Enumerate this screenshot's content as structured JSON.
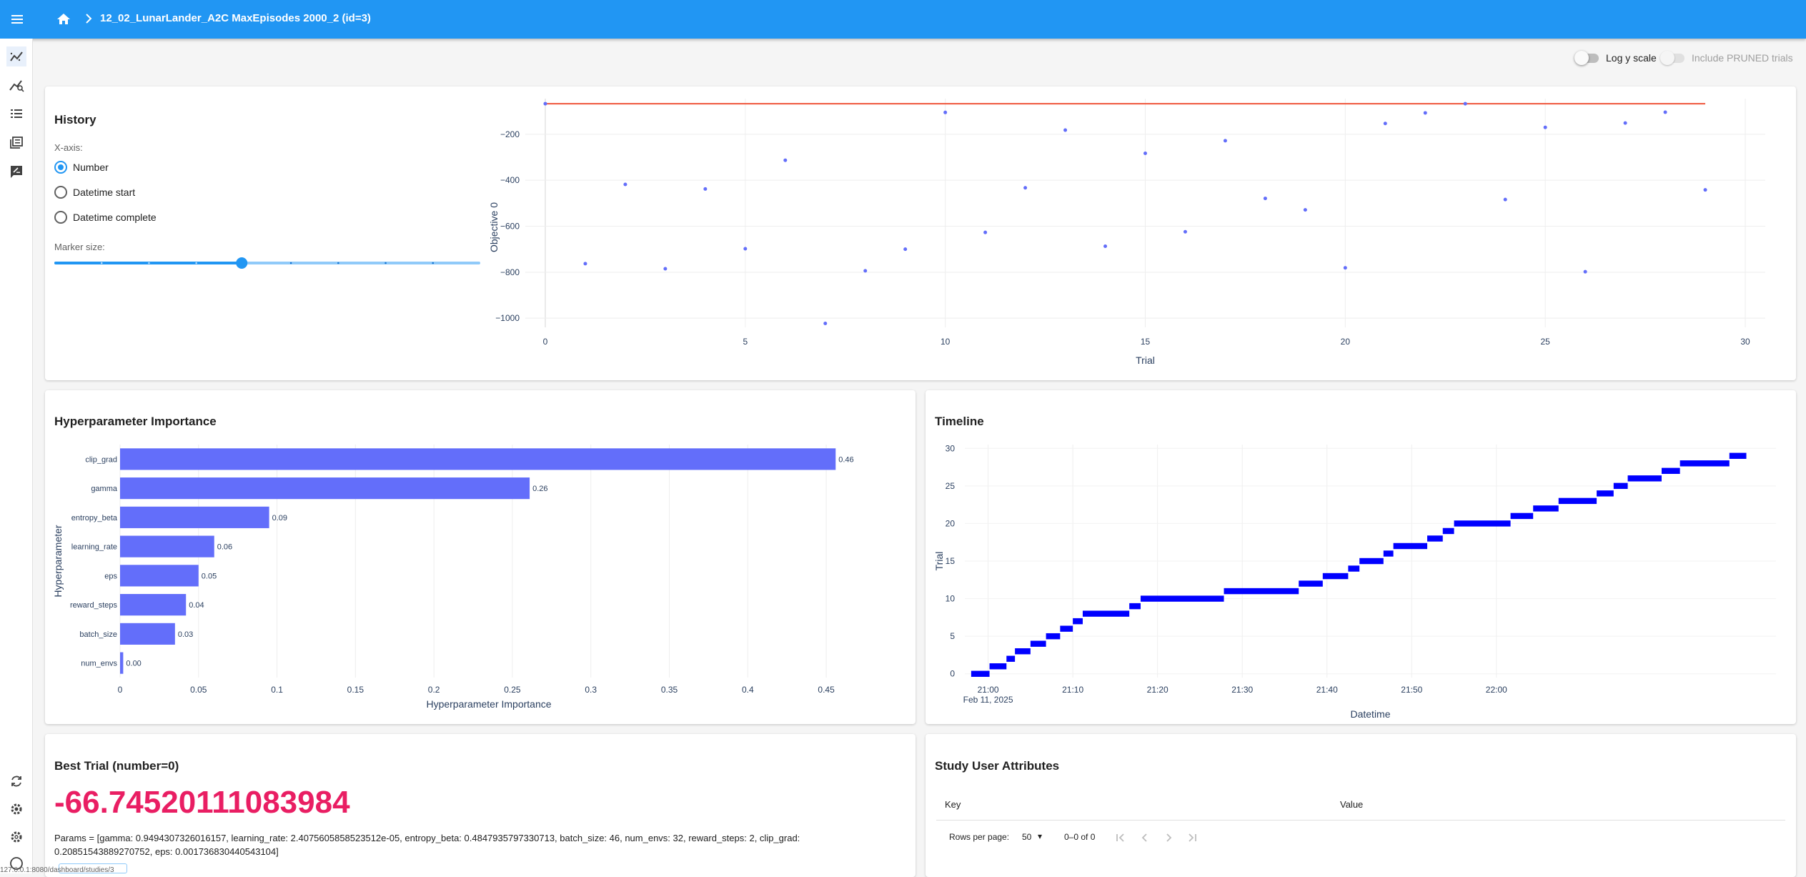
{
  "app": {
    "title": "12_02_LunarLander_A2C MaxEpisodes 2000_2 (id=3)",
    "accent_color": "#2196f3"
  },
  "sidebar": {
    "items": [
      {
        "icon": "history-chart-icon",
        "active": true
      },
      {
        "icon": "analytics-icon",
        "active": false
      },
      {
        "icon": "table-list-icon",
        "active": false
      },
      {
        "icon": "library-icon",
        "active": false
      },
      {
        "icon": "note-icon",
        "active": false
      }
    ],
    "bottom_items": [
      {
        "icon": "refresh-icon"
      },
      {
        "icon": "settings-icon"
      },
      {
        "icon": "gear-icon"
      },
      {
        "icon": "help-icon"
      }
    ]
  },
  "history": {
    "title": "History",
    "log_scale_label": "Log y scale",
    "pruned_label": "Include PRUNED trials",
    "xaxis_label": "X-axis:",
    "xaxis_options": [
      "Number",
      "Datetime start",
      "Datetime complete"
    ],
    "xaxis_selected": "Number",
    "marker_size_label": "Marker size:",
    "marker_size_fraction": 0.44
  },
  "importance": {
    "title": "Hyperparameter Importance"
  },
  "timeline": {
    "title": "Timeline"
  },
  "best_trial": {
    "title": "Best Trial (number=0)",
    "value": "-66.74520111083984",
    "params_text": "Params = [gamma: 0.9494307326016157, learning_rate: 2.4075605858523512e-05, entropy_beta: 0.4847935797330713, batch_size: 46, num_envs: 32, reward_steps: 2, clip_grad: 0.20851543889270752, eps: 0.001736830440543104]"
  },
  "user_attrs": {
    "title": "Study User Attributes",
    "columns": [
      "Key",
      "Value"
    ],
    "rows_per_page_label": "Rows per page:",
    "rows_per_page": "50",
    "range": "0–0 of 0"
  },
  "status_text": "127.0.0.1:8080/dashboard/studies/3",
  "chart_data": [
    {
      "type": "scatter",
      "xlabel": "Trial",
      "ylabel": "Objective 0",
      "xlim": [
        -0.5,
        30.5
      ],
      "ylim": [
        -1040,
        -45
      ],
      "xticks": [
        0,
        5,
        10,
        15,
        20,
        25,
        30
      ],
      "yticks": [
        -200,
        -400,
        -600,
        -800,
        -1000
      ],
      "grid": true,
      "color": "#636efa",
      "best_line_color": "#ef553b",
      "x": [
        0,
        1,
        2,
        3,
        4,
        5,
        6,
        7,
        8,
        9,
        10,
        11,
        12,
        13,
        14,
        15,
        16,
        17,
        18,
        19,
        20,
        21,
        22,
        23,
        24,
        25,
        26,
        27,
        28,
        29
      ],
      "values": [
        -67,
        -763,
        -418,
        -785,
        -438,
        -698,
        -313,
        -1023,
        -794,
        -700,
        -105,
        -627,
        -433,
        -182,
        -687,
        -283,
        -624,
        -228,
        -479,
        -529,
        -781,
        -153,
        -107,
        -67,
        -484,
        -170,
        -798,
        -151,
        -104,
        -442
      ],
      "best_values": [
        -67,
        -67,
        -67,
        -67,
        -67,
        -67,
        -67,
        -67,
        -67,
        -67,
        -67,
        -67,
        -67,
        -67,
        -67,
        -67,
        -67,
        -67,
        -67,
        -67,
        -67,
        -67,
        -67,
        -67,
        -67,
        -67,
        -67,
        -67,
        -67,
        -67
      ]
    },
    {
      "type": "bar",
      "orientation": "horizontal",
      "xlabel": "Hyperparameter Importance",
      "ylabel": "Hyperparameter",
      "xlim": [
        0,
        0.47
      ],
      "xticks": [
        "0",
        "0.05",
        "0.1",
        "0.15",
        "0.2",
        "0.25",
        "0.3",
        "0.35",
        "0.4",
        "0.45"
      ],
      "color": "#636efa",
      "categories": [
        "clip_grad",
        "gamma",
        "entropy_beta",
        "learning_rate",
        "eps",
        "reward_steps",
        "batch_size",
        "num_envs"
      ],
      "values": [
        0.456,
        0.261,
        0.095,
        0.06,
        0.05,
        0.042,
        0.035,
        0.002
      ],
      "labels": [
        "0.46",
        "0.26",
        "0.09",
        "0.06",
        "0.05",
        "0.04",
        "0.03",
        "0.00"
      ]
    },
    {
      "type": "bar",
      "subtype": "timeline",
      "xlabel": "Datetime",
      "ylabel": "Trial",
      "color": "#0000ff",
      "xticks": [
        "21:00",
        "21:10",
        "21:20",
        "21:30",
        "21:40",
        "21:50",
        "22:00"
      ],
      "xtick_sublabel": "Feb 11, 2025",
      "yticks": [
        0,
        5,
        10,
        15,
        20,
        25,
        30
      ],
      "ylim": [
        -0.5,
        30.5
      ],
      "trials": [
        {
          "n": 0,
          "start": "20:58:00",
          "end": "21:00:10"
        },
        {
          "n": 1,
          "start": "21:00:10",
          "end": "21:02:10"
        },
        {
          "n": 2,
          "start": "21:02:10",
          "end": "21:03:10"
        },
        {
          "n": 3,
          "start": "21:03:10",
          "end": "21:05:00"
        },
        {
          "n": 4,
          "start": "21:05:00",
          "end": "21:06:50"
        },
        {
          "n": 5,
          "start": "21:06:50",
          "end": "21:08:30"
        },
        {
          "n": 6,
          "start": "21:08:30",
          "end": "21:10:00"
        },
        {
          "n": 7,
          "start": "21:10:00",
          "end": "21:11:10"
        },
        {
          "n": 8,
          "start": "21:11:10",
          "end": "21:16:40"
        },
        {
          "n": 9,
          "start": "21:16:40",
          "end": "21:18:00"
        },
        {
          "n": 10,
          "start": "21:18:00",
          "end": "21:27:50"
        },
        {
          "n": 11,
          "start": "21:27:50",
          "end": "21:36:40"
        },
        {
          "n": 12,
          "start": "21:36:40",
          "end": "21:39:30"
        },
        {
          "n": 13,
          "start": "21:39:30",
          "end": "21:42:30"
        },
        {
          "n": 14,
          "start": "21:42:30",
          "end": "21:43:50"
        },
        {
          "n": 15,
          "start": "21:43:50",
          "end": "21:46:40"
        },
        {
          "n": 16,
          "start": "21:46:40",
          "end": "21:47:50"
        },
        {
          "n": 17,
          "start": "21:47:50",
          "end": "21:51:50"
        },
        {
          "n": 18,
          "start": "21:51:50",
          "end": "21:53:40"
        },
        {
          "n": 19,
          "start": "21:53:40",
          "end": "21:55:00"
        },
        {
          "n": 20,
          "start": "21:55:00",
          "end": "22:01:40"
        },
        {
          "n": 21,
          "start": "22:01:40",
          "end": "22:04:20"
        },
        {
          "n": 22,
          "start": "22:04:20",
          "end": "22:07:20"
        },
        {
          "n": 23,
          "start": "22:07:20",
          "end": "22:11:50"
        },
        {
          "n": 24,
          "start": "22:11:50",
          "end": "22:13:50"
        },
        {
          "n": 25,
          "start": "22:13:50",
          "end": "22:15:30"
        },
        {
          "n": 26,
          "start": "22:15:30",
          "end": "22:19:30"
        },
        {
          "n": 27,
          "start": "22:19:30",
          "end": "22:21:40"
        },
        {
          "n": 28,
          "start": "22:21:40",
          "end": "22:27:30"
        },
        {
          "n": 29,
          "start": "22:27:30",
          "end": "22:29:30"
        }
      ]
    }
  ]
}
